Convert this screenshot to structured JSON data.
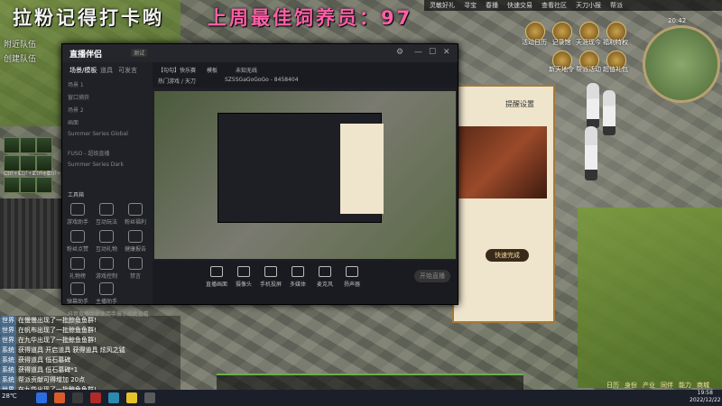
{
  "overlay": {
    "headline_left": "拉粉记得打卡哟",
    "headline_right": "上周最佳饲养员：97",
    "headline_right_color": "#ff5fa8"
  },
  "team_panel": {
    "items": [
      "附近队伍",
      "创建队伍"
    ]
  },
  "skill_bar": {
    "keys": [
      "Ctrl+1",
      "Ctrl+2",
      "Ctrl+3",
      "Ctrl+4"
    ]
  },
  "game_hud": {
    "top_items": [
      "灵敏好礼",
      "寻宝",
      "春播",
      "快速交易",
      "查看社区",
      "天刀小报",
      "帮派"
    ],
    "icons": [
      "活动日历",
      "记录馆",
      "天涯现今",
      "福利特权",
      "新天地令",
      "帮派活动",
      "超值礼包"
    ],
    "time": "20:42",
    "map_label": "天香谷"
  },
  "quest_panel": {
    "title": "提醒设置",
    "confirm_label": "快速完成"
  },
  "chat": {
    "lines": [
      {
        "tag": "世界",
        "text": "在慢慢出现了一批鲸鱼鱼群!"
      },
      {
        "tag": "世界",
        "text": "在帆布出现了一批鲸鱼鱼群!"
      },
      {
        "tag": "世界",
        "text": "在九华出现了一批鲸鱼鱼群!"
      },
      {
        "tag": "系统",
        "text": "获得道具 开启道具 获得道具 炫风之钺"
      },
      {
        "tag": "系统",
        "text": "获得道具 低石墓碑"
      },
      {
        "tag": "系统",
        "text": "获得道具 低石墓碑*1"
      },
      {
        "tag": "系统",
        "text": "帮派贡献可得增加 20点"
      },
      {
        "tag": "世界",
        "text": "在九华出现了一批鲸鱼鱼群!"
      },
      {
        "tag": "系统",
        "text": "获得道具 开启道具 获得道具"
      }
    ]
  },
  "bottom_menu": [
    "日历",
    "身份",
    "产业",
    "同伴",
    "能力",
    "商城"
  ],
  "streaming_app": {
    "logo": "直播伴侣",
    "version": "测试",
    "sidebar_tabs": [
      "场景/模板",
      "道具",
      "可发言"
    ],
    "scenes": [
      "场景 1",
      "窗口捕获",
      "场景 2",
      "画面",
      "Summer Series Global",
      "FUSO - 超级直播",
      "Summer Series Dark"
    ],
    "tools_title": "工具箱",
    "tools": [
      "游戏助手",
      "互动玩法",
      "粉丝福利",
      "粉丝点赞",
      "互动礼物",
      "健康报告",
      "礼物榜",
      "游戏控制",
      "禁言",
      "弹幕助手",
      "主播助手"
    ],
    "footer": "抖音直播伴侣使用手册 | 点此查看详情",
    "top_title": "【勾勾】快乐赛",
    "top_tag1": "模板",
    "top_tag2": "未知无线",
    "top_meta": "热门游戏 / 天刀",
    "top_id": "SZ5SGaGoGoGo - 8458404",
    "controls": [
      "直播画面",
      "摄像头",
      "手机投屏",
      "多媒体",
      "麦克风",
      "扬声器"
    ],
    "start_label": "开始直播"
  },
  "taskbar": {
    "weather": "28℃",
    "time": "19:58",
    "date": "2022/12/22"
  }
}
